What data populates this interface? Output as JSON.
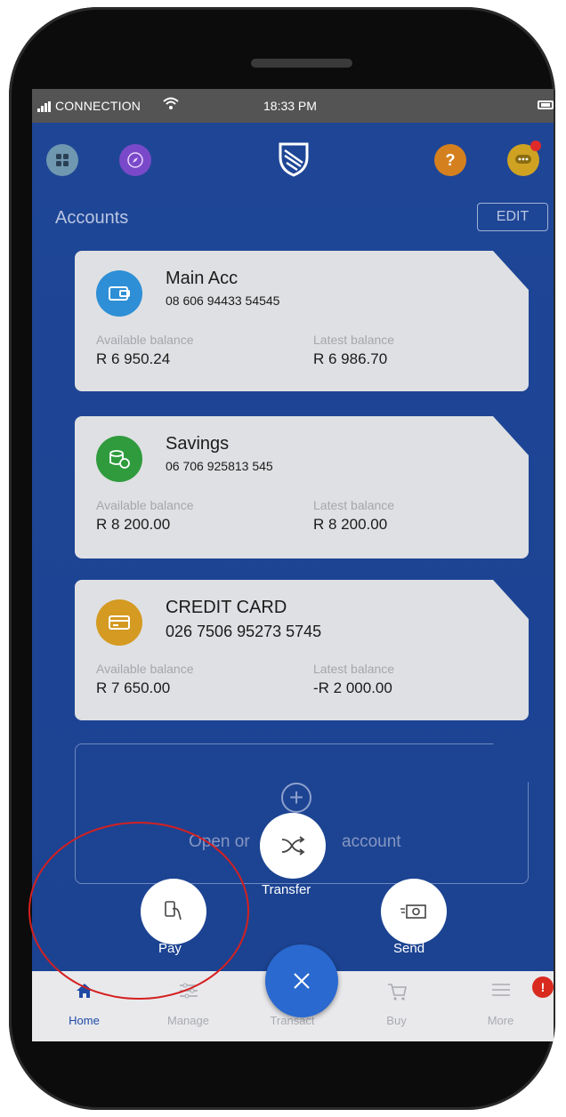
{
  "status_bar": {
    "signal_icon": "signal-bars-icon",
    "connection": "CONNECTION",
    "wifi_icon": "wifi-icon",
    "time": "18:33 PM",
    "battery_icon": "battery-icon"
  },
  "header": {
    "left_icons": [
      "grid-icon",
      "compass-icon"
    ],
    "logo_icon": "bank-shield-logo",
    "right_icons": [
      "help-icon",
      "chat-icon"
    ]
  },
  "accounts_section": {
    "title": "Accounts",
    "edit_label": "EDIT"
  },
  "accounts": [
    {
      "name": "Main Acc",
      "number": "08 606 94433 54545",
      "icon": "wallet-icon",
      "icon_color": "#2e8fd6",
      "available_label": "Available balance",
      "available_value": "R 6 950.24",
      "latest_label": "Latest balance",
      "latest_value": "R 6 986.70"
    },
    {
      "name": "Savings",
      "number": "06 706 925813 545",
      "icon": "coins-icon",
      "icon_color": "#2f9b3d",
      "available_label": "Available balance",
      "available_value": "R 8 200.00",
      "latest_label": "Latest balance",
      "latest_value": "R 8 200.00"
    },
    {
      "name": "CREDIT CARD",
      "number": "026 7506 95273 5745",
      "icon": "credit-card-icon",
      "icon_color": "#d49a21",
      "available_label": "Available balance",
      "available_value": "R 7 650.00",
      "latest_label": "Latest balance",
      "latest_value": "-R 2 000.00"
    }
  ],
  "open_account": {
    "text_start": "Open or",
    "text_end": "account"
  },
  "transact_menu": {
    "transfer_label": "Transfer",
    "pay_label": "Pay",
    "send_label": "Send"
  },
  "tabs": [
    {
      "label": "Home",
      "icon": "home-icon",
      "active": true
    },
    {
      "label": "Manage",
      "icon": "sliders-icon",
      "active": false
    },
    {
      "label": "Transact",
      "icon": "close-icon",
      "active": false
    },
    {
      "label": "Buy",
      "icon": "cart-icon",
      "active": false
    },
    {
      "label": "More",
      "icon": "menu-icon",
      "active": false
    }
  ],
  "more_badge": "!",
  "colors": {
    "screen_bg": "#1f4696",
    "accent": "#2a69cf",
    "highlight_ring": "#d42020"
  }
}
